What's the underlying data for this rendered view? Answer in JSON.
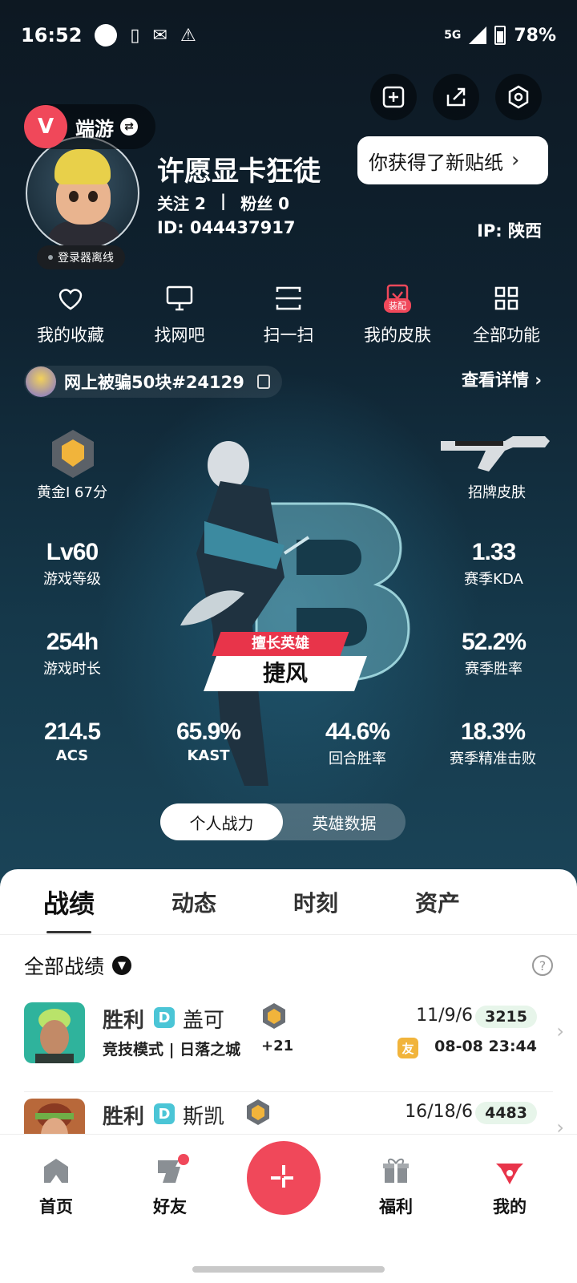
{
  "status_bar": {
    "time": "16:52",
    "network": "5G",
    "battery": "78%"
  },
  "colors": {
    "accent": "#f0485a",
    "badge_teal": "#4bc5d6",
    "friend_tag": "#f1b43b"
  },
  "header": {
    "sticker_tip": "你获得了新贴纸",
    "game_name": "端游",
    "login_status": "登录器离线",
    "username": "许愿显卡狂徒",
    "follow_label": "关注",
    "follow_count": "2",
    "fans_label": "粉丝",
    "fans_count": "0",
    "id_text": "ID: 044437917",
    "ip_text": "IP: 陕西",
    "icons": [
      "sticker-icon",
      "share-icon",
      "settings-icon"
    ]
  },
  "quick_menu": [
    {
      "label": "我的收藏",
      "icon": "heart-icon"
    },
    {
      "label": "找网吧",
      "icon": "monitor-icon"
    },
    {
      "label": "扫一扫",
      "icon": "scan-icon"
    },
    {
      "label": "我的皮肤",
      "icon": "skin-icon",
      "tag": "装配"
    },
    {
      "label": "全部功能",
      "icon": "grid-icon"
    }
  ],
  "team": {
    "name": "网上被骗50块#24129",
    "detail_link": "查看详情"
  },
  "stats": {
    "rank": "黄金I 67分",
    "skin_label": "招牌皮肤",
    "level_value": "Lv60",
    "level_label": "游戏等级",
    "kda_value": "1.33",
    "kda_label": "赛季KDA",
    "hours_value": "254h",
    "hours_label": "游戏时长",
    "winrate_value": "52.2%",
    "winrate_label": "赛季胜率",
    "acs_value": "214.5",
    "acs_label": "ACS",
    "kast_value": "65.9%",
    "kast_label": "KAST",
    "round_win_value": "44.6%",
    "round_win_label": "回合胜率",
    "hs_value": "18.3%",
    "hs_label": "赛季精准击败",
    "main_hero_tag": "擅长英雄",
    "main_hero_name": "捷风",
    "toggle": [
      "个人战力",
      "英雄数据"
    ],
    "toggle_active": 0
  },
  "tabs": [
    "战绩",
    "动态",
    "时刻",
    "资产"
  ],
  "filter": {
    "label": "全部战绩"
  },
  "matches": [
    {
      "result": "胜利",
      "agent_badge": "D",
      "agent": "盖可",
      "mode": "竞技模式 | 日落之城",
      "delta": "+21",
      "kda": "11/9/6",
      "score": "3215",
      "friend_tag": "友",
      "time": "08-08 23:44"
    },
    {
      "result": "胜利",
      "agent_badge": "D",
      "agent": "斯凯",
      "kda": "16/18/6",
      "score": "4483"
    }
  ],
  "bottom_nav": [
    {
      "label": "首页",
      "icon": "home-icon"
    },
    {
      "label": "好友",
      "icon": "friends-icon"
    },
    {
      "label": "",
      "icon": "plus-icon"
    },
    {
      "label": "福利",
      "icon": "gift-icon"
    },
    {
      "label": "我的",
      "icon": "profile-icon"
    }
  ]
}
